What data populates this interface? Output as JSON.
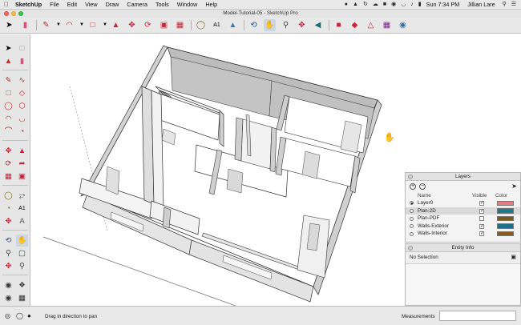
{
  "menubar": {
    "app_name": "SketchUp",
    "items": [
      "File",
      "Edit",
      "View",
      "Draw",
      "Camera",
      "Tools",
      "Window",
      "Help"
    ],
    "clock": "Sun 7:34 PM",
    "user": "Jillian Lare"
  },
  "window": {
    "title": "Model-Tutorial-05 - SketchUp Pro"
  },
  "layers_panel": {
    "title": "Layers",
    "columns": {
      "name": "Name",
      "visible": "Visible",
      "color": "Color"
    },
    "rows": [
      {
        "name": "Layer0",
        "active": true,
        "visible": true,
        "color": "#e87a84"
      },
      {
        "name": "Plan-2D",
        "active": false,
        "visible": true,
        "color": "#1c7a8a"
      },
      {
        "name": "Plan-PDF",
        "active": false,
        "visible": false,
        "color": "#7a5b1d"
      },
      {
        "name": "Walls-Exterior",
        "active": false,
        "visible": true,
        "color": "#1e6f8c"
      },
      {
        "name": "Walls-Interior",
        "active": false,
        "visible": true,
        "color": "#8a5a1c"
      }
    ]
  },
  "entity_info": {
    "title": "Entity Info",
    "selection": "No Selection"
  },
  "statusbar": {
    "message": "Drag in direction to pan",
    "measurements_label": "Measurements"
  },
  "icons": {
    "top_toolbar": [
      "select-arrow",
      "eraser",
      "pencil-line",
      "arc",
      "shapes",
      "push-pull",
      "move",
      "rotate",
      "offset",
      "scale",
      "tape-measure",
      "text-label",
      "paint-bucket",
      "orbit",
      "pan",
      "zoom",
      "zoom-extents",
      "previous-view",
      "warehouse",
      "extension-warehouse",
      "share-model",
      "layout",
      "style"
    ]
  }
}
